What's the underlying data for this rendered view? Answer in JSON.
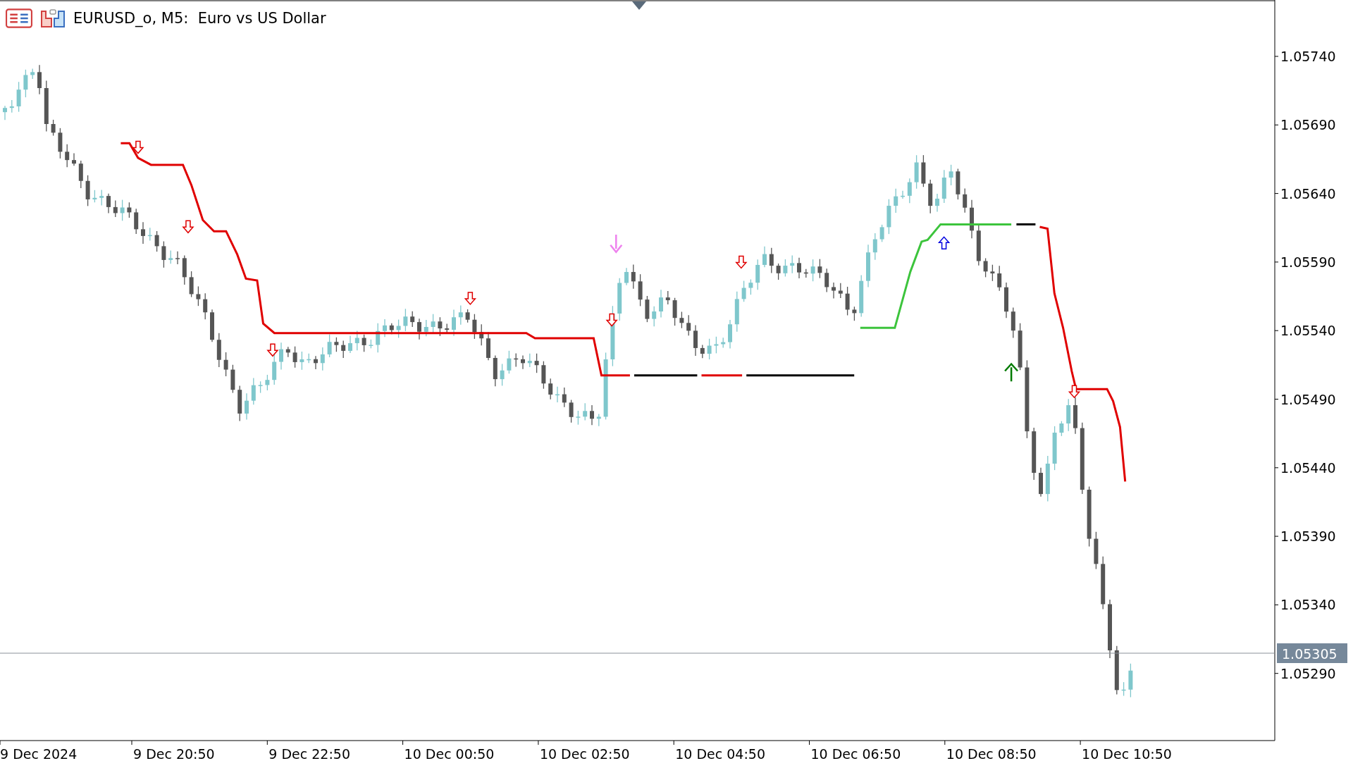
{
  "title": "EURUSD_o, M5:  Euro vs US Dollar",
  "price_axis": [
    "1.05740",
    "1.05690",
    "1.05640",
    "1.05590",
    "1.05540",
    "1.05490",
    "1.05440",
    "1.05390",
    "1.05340",
    "1.05290"
  ],
  "current_price": "1.05305",
  "time_axis": [
    "9 Dec 2024",
    "9 Dec 20:50",
    "9 Dec 22:50",
    "10 Dec 00:50",
    "10 Dec 02:50",
    "10 Dec 04:50",
    "10 Dec 06:50",
    "10 Dec 08:50",
    "10 Dec 10:50"
  ]
}
